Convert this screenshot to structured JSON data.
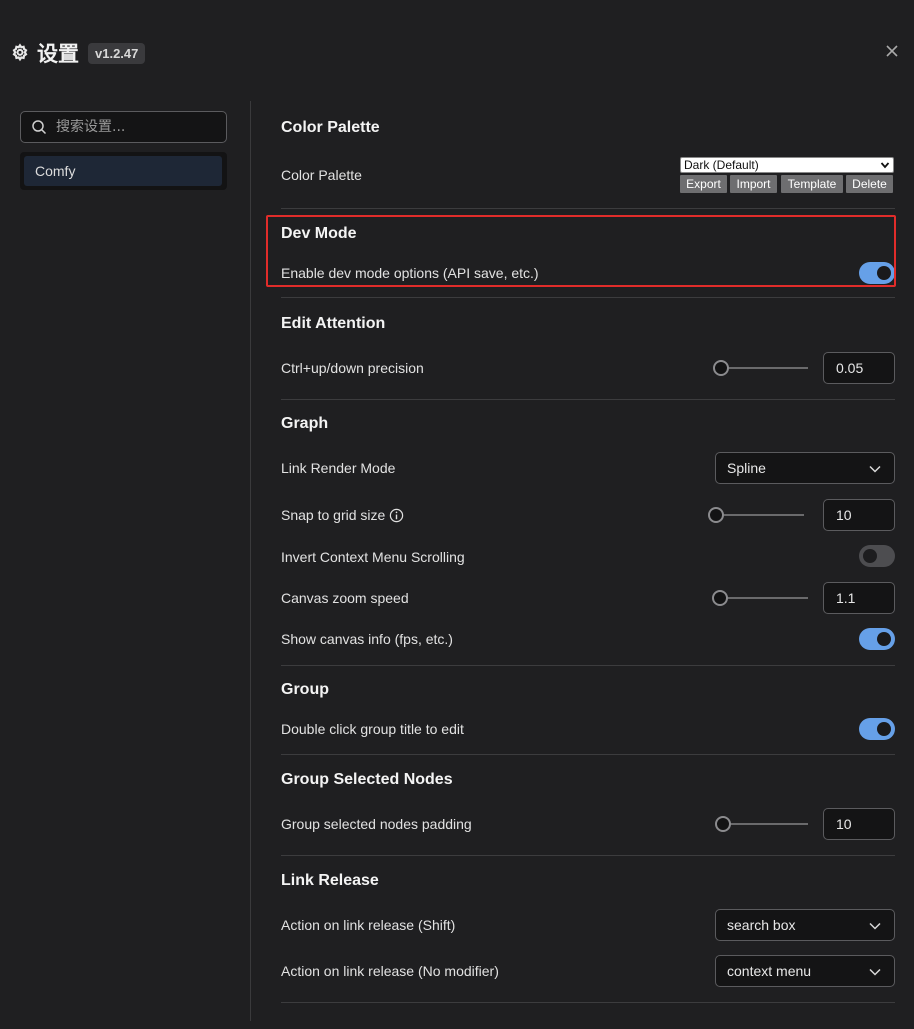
{
  "header": {
    "title": "设置",
    "version": "v1.2.47"
  },
  "sidebar": {
    "search_placeholder": "搜索设置...",
    "items": [
      {
        "label": "Comfy"
      }
    ]
  },
  "sections": {
    "color_palette": {
      "title": "Color Palette",
      "row_label": "Color Palette",
      "selected": "Dark (Default)",
      "buttons": {
        "export": "Export",
        "import": "Import",
        "template": "Template",
        "delete": "Delete"
      }
    },
    "dev_mode": {
      "title": "Dev Mode",
      "enable_label": "Enable dev mode options (API save, etc.)",
      "enable_value": true
    },
    "edit_attention": {
      "title": "Edit Attention",
      "precision_label": "Ctrl+up/down precision",
      "precision_value": "0.05"
    },
    "graph": {
      "title": "Graph",
      "link_render_label": "Link Render Mode",
      "link_render_value": "Spline",
      "snap_label": "Snap to grid size",
      "snap_value": "10",
      "invert_label": "Invert Context Menu Scrolling",
      "invert_value": false,
      "zoom_label": "Canvas zoom speed",
      "zoom_value": "1.1",
      "canvas_info_label": "Show canvas info (fps, etc.)",
      "canvas_info_value": true
    },
    "group": {
      "title": "Group",
      "dblclick_label": "Double click group title to edit",
      "dblclick_value": true
    },
    "group_selected": {
      "title": "Group Selected Nodes",
      "padding_label": "Group selected nodes padding",
      "padding_value": "10"
    },
    "link_release": {
      "title": "Link Release",
      "shift_label": "Action on link release (Shift)",
      "shift_value": "search box",
      "nomod_label": "Action on link release (No modifier)",
      "nomod_value": "context menu"
    }
  },
  "colors": {
    "accent": "#66a0e8",
    "highlight_border": "#e02c2a",
    "background": "#1f1f21"
  }
}
